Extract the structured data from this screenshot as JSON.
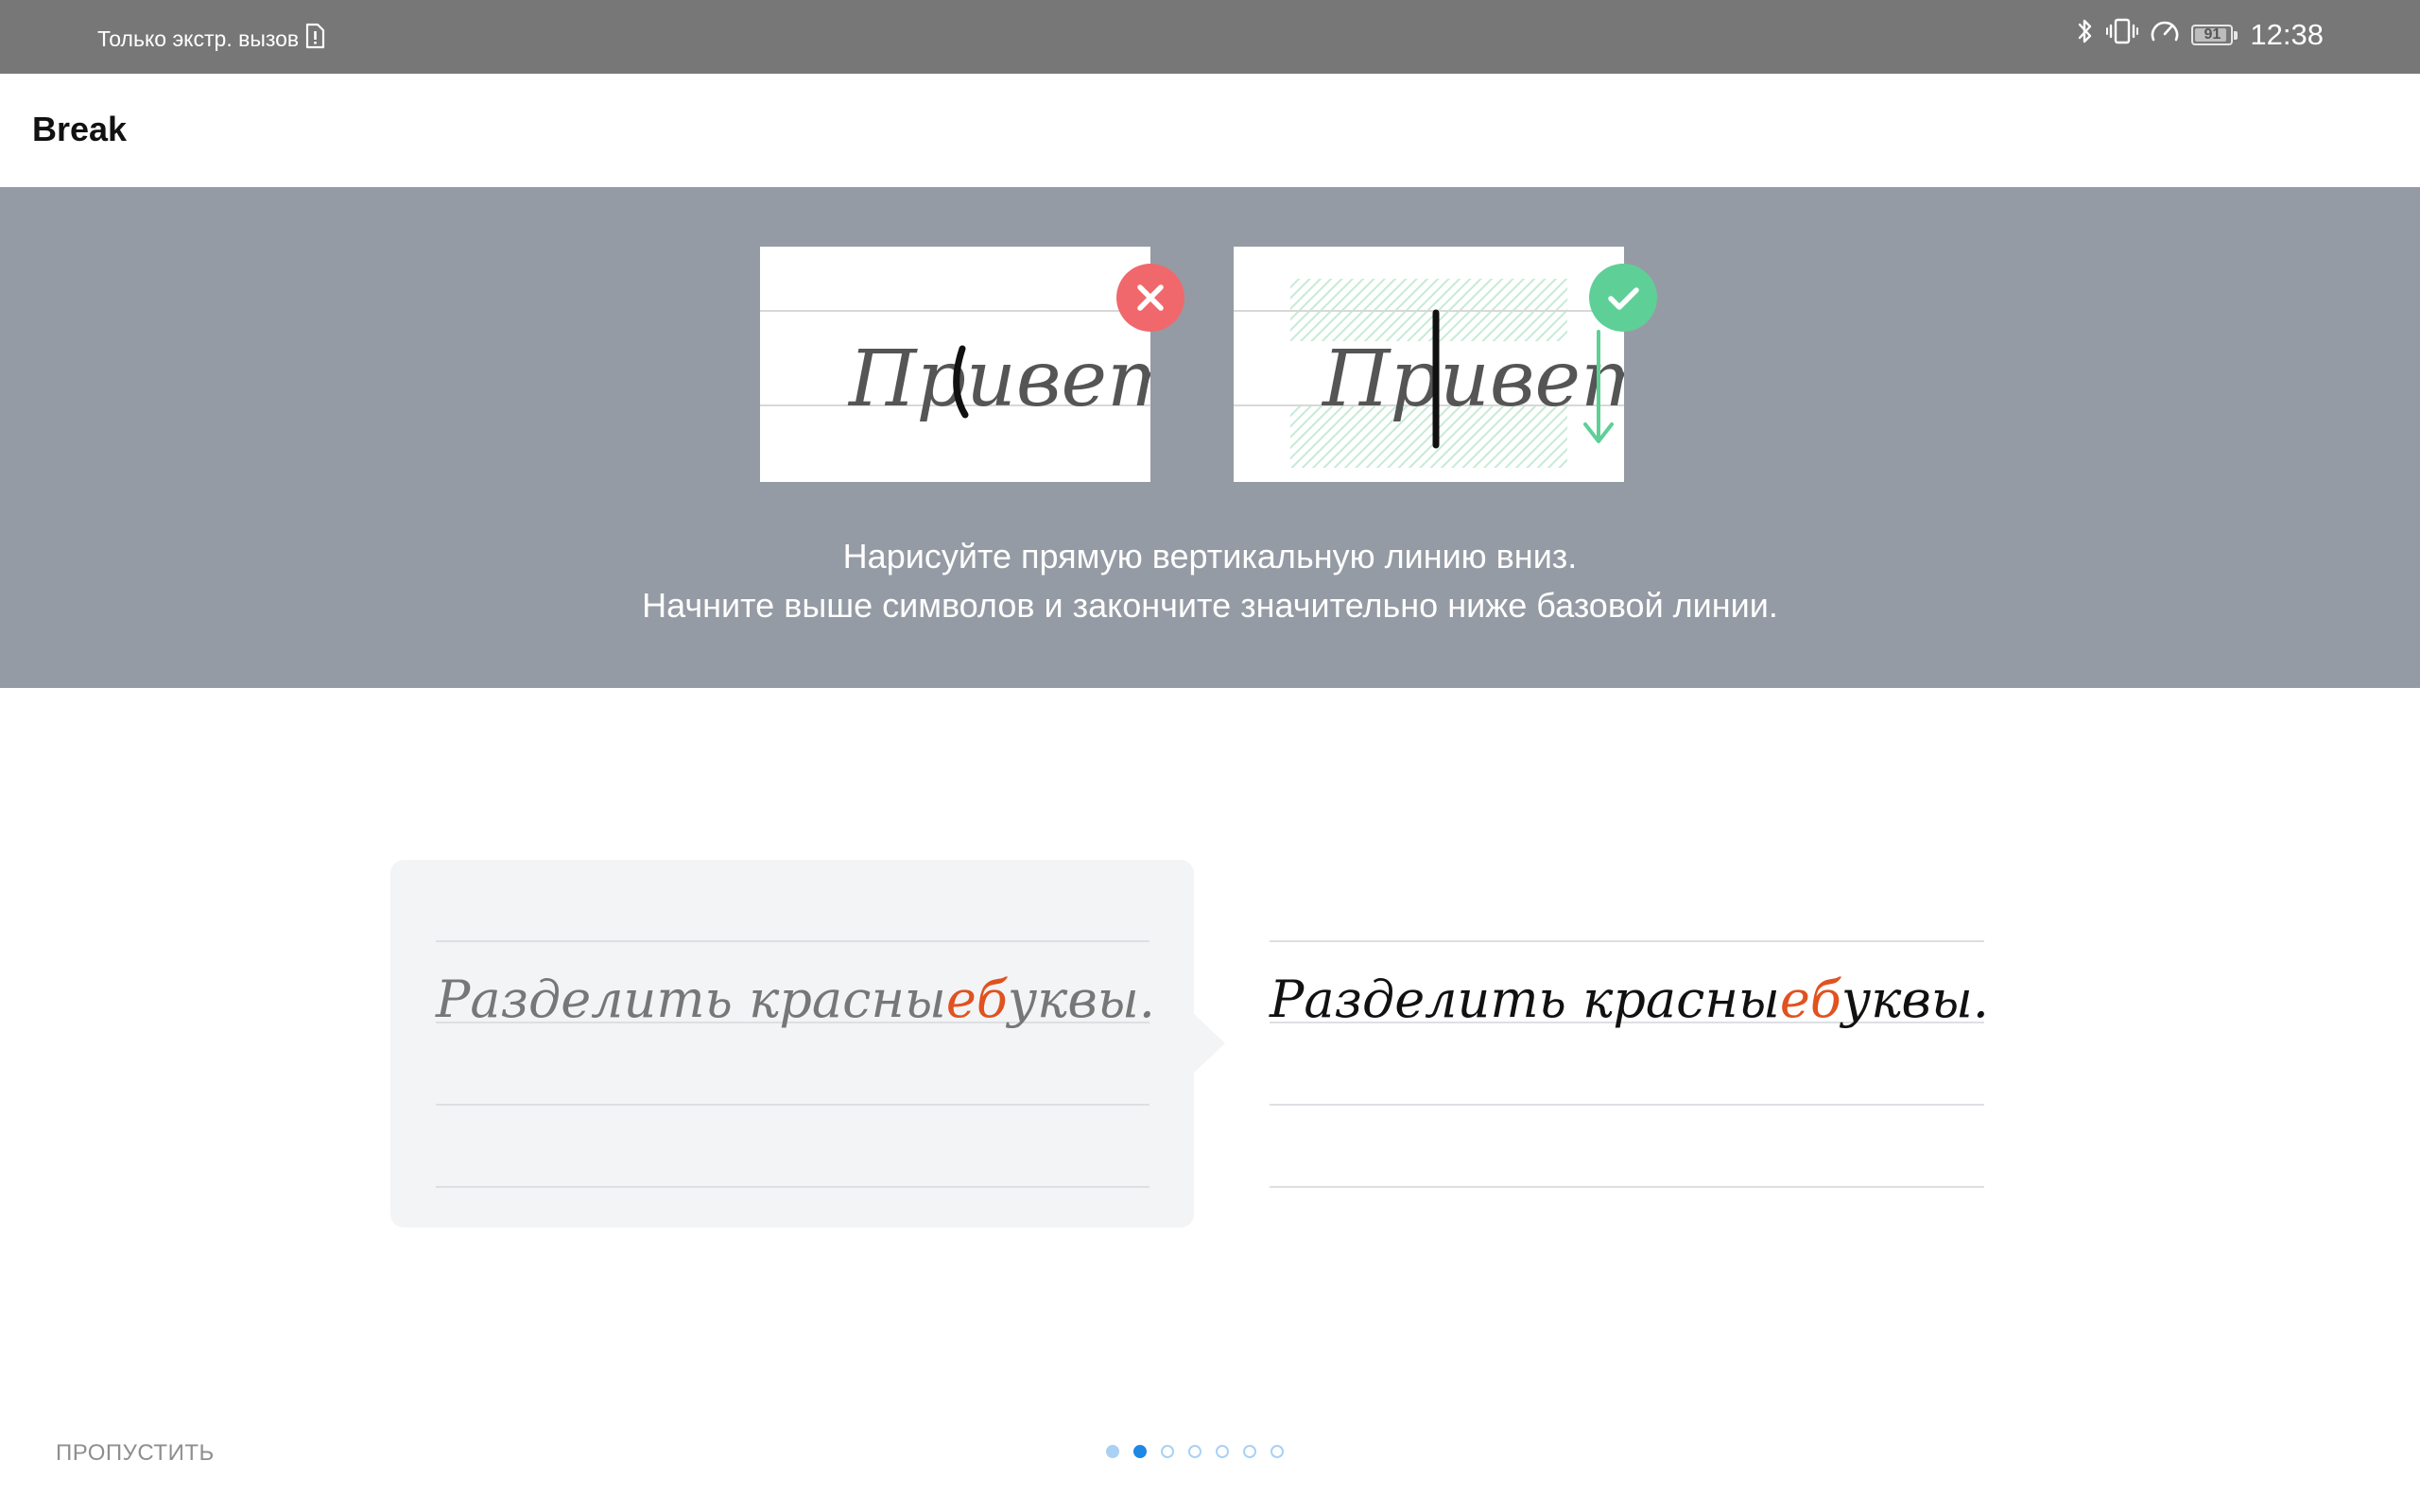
{
  "status_bar": {
    "carrier_text": "Только экстр. вызов",
    "battery_level": "91",
    "time": "12:38"
  },
  "app_bar": {
    "title": "Break"
  },
  "instruction": {
    "wrong_example_word": "Привет",
    "correct_example_word": "Привет",
    "line1": "Нарисуйте прямую вертикальную линию вниз.",
    "line2": "Начните выше символов и закончите значительно ниже базовой линии."
  },
  "demo": {
    "before": {
      "part1": "Разделить красны",
      "highlight": "еб",
      "part2": "уквы."
    },
    "after": {
      "part1": "Разделить красны",
      "highlight": "еб",
      "part2": "уквы."
    }
  },
  "footer": {
    "skip_label": "ПРОПУСТИТЬ",
    "page_count": 7,
    "current_page": 2
  },
  "colors": {
    "status_bar": "#777777",
    "panel": "#959ba4",
    "wrong_badge": "#f0686b",
    "correct_badge": "#5fcf98",
    "highlight": "#e0521f",
    "accent": "#1e88e5"
  },
  "icons": {
    "sim": "sim-alert-icon",
    "bluetooth": "bluetooth-icon",
    "vibrate": "vibrate-icon",
    "speed": "speedometer-icon",
    "battery": "battery-icon",
    "wrong": "close-icon",
    "correct": "check-icon"
  }
}
